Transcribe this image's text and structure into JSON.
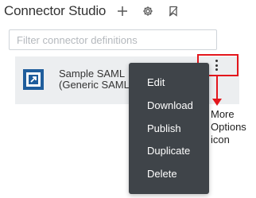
{
  "header": {
    "title": "Connector Studio",
    "icons": [
      "add-icon",
      "gear-icon",
      "bookmark-icon"
    ]
  },
  "search": {
    "placeholder": "Filter connector definitions",
    "value": ""
  },
  "connector": {
    "name": "Sample SAML",
    "subtitle": "(Generic SAML",
    "icon": "external-link-icon",
    "icon_color": "#1f5d9c"
  },
  "more_options": {
    "icon": "more-vertical-icon"
  },
  "menu": {
    "items": [
      "Edit",
      "Download",
      "Publish",
      "Duplicate",
      "Delete"
    ]
  },
  "annotation": {
    "label_lines": [
      "More",
      "Options",
      "icon"
    ],
    "color": "#e3161c"
  }
}
